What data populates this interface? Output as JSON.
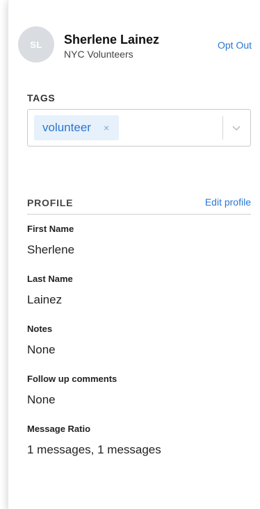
{
  "contact": {
    "initials": "SL",
    "name": "Sherlene Lainez",
    "group": "NYC Volunteers",
    "opt_out_label": "Opt Out"
  },
  "tags": {
    "label": "TAGS",
    "items": [
      {
        "label": "volunteer",
        "remove_symbol": "×"
      }
    ],
    "dropdown_icon": "chevron-down-icon"
  },
  "profile": {
    "title": "PROFILE",
    "edit_label": "Edit profile",
    "fields": [
      {
        "label": "First Name",
        "value": "Sherlene"
      },
      {
        "label": "Last Name",
        "value": "Lainez"
      },
      {
        "label": "Notes",
        "value": "None"
      },
      {
        "label": "Follow up comments",
        "value": "None"
      },
      {
        "label": "Message Ratio",
        "value": "1 messages, 1 messages"
      }
    ]
  },
  "colors": {
    "accent": "#2b76d2",
    "tag_background": "#e7f1fb",
    "avatar_background": "#d9dce1"
  }
}
